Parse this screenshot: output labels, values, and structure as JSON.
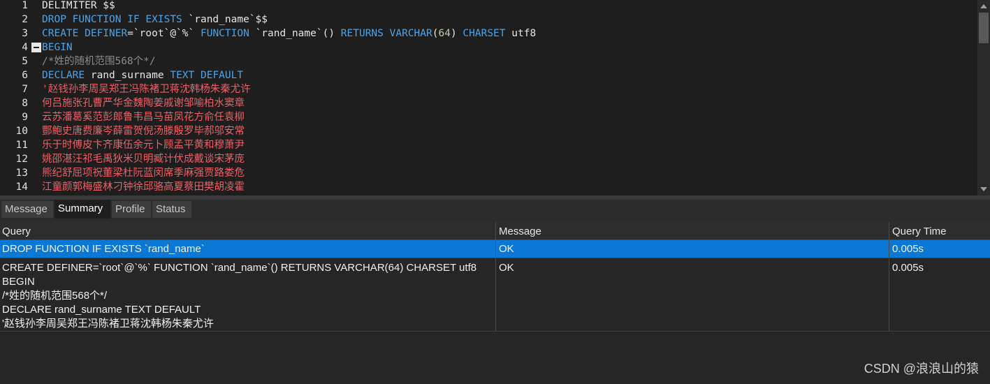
{
  "editor": {
    "lines": [
      {
        "n": "1",
        "parts": [
          {
            "c": "tx",
            "t": "DELIMITER $$"
          }
        ]
      },
      {
        "n": "2",
        "parts": [
          {
            "c": "kw",
            "t": "DROP FUNCTION IF EXISTS "
          },
          {
            "c": "tx",
            "t": "`rand_name`$$"
          }
        ]
      },
      {
        "n": "3",
        "parts": [
          {
            "c": "kw",
            "t": "CREATE DEFINER"
          },
          {
            "c": "tx",
            "t": "=`root`@`%` "
          },
          {
            "c": "kw",
            "t": "FUNCTION "
          },
          {
            "c": "tx",
            "t": "`rand_name`() "
          },
          {
            "c": "kw",
            "t": "RETURNS VARCHAR"
          },
          {
            "c": "tx",
            "t": "("
          },
          {
            "c": "nm",
            "t": "64"
          },
          {
            "c": "tx",
            "t": ") "
          },
          {
            "c": "kw",
            "t": "CHARSET "
          },
          {
            "c": "tx",
            "t": "utf8"
          }
        ]
      },
      {
        "n": "4",
        "parts": [
          {
            "c": "kw",
            "t": "BEGIN"
          }
        ],
        "fold": true
      },
      {
        "n": "5",
        "parts": [
          {
            "c": "cm",
            "t": "/*姓的随机范围568个*/"
          }
        ]
      },
      {
        "n": "6",
        "parts": [
          {
            "c": "kw",
            "t": "DECLARE "
          },
          {
            "c": "tx",
            "t": "rand_surname "
          },
          {
            "c": "kw",
            "t": "TEXT DEFAULT"
          }
        ]
      },
      {
        "n": "7",
        "parts": [
          {
            "c": "st",
            "t": "'赵钱孙李周吴郑王冯陈褚卫蒋沈韩杨朱秦尤许"
          }
        ]
      },
      {
        "n": "8",
        "parts": [
          {
            "c": "st",
            "t": "何吕施张孔曹严华金魏陶姜戚谢邹喻柏水窦章"
          }
        ]
      },
      {
        "n": "9",
        "parts": [
          {
            "c": "st",
            "t": "云苏潘葛奚范彭郎鲁韦昌马苗凤花方俞任袁柳"
          }
        ]
      },
      {
        "n": "10",
        "parts": [
          {
            "c": "st",
            "t": "酆鲍史唐费廉岑薛雷贺倪汤滕殷罗毕郝邬安常"
          }
        ]
      },
      {
        "n": "11",
        "parts": [
          {
            "c": "st",
            "t": "乐于时傅皮卞齐康伍余元卜顾孟平黄和穆萧尹"
          }
        ]
      },
      {
        "n": "12",
        "parts": [
          {
            "c": "st",
            "t": "姚邵湛汪祁毛禹狄米贝明臧计伏成戴谈宋茅庞"
          }
        ]
      },
      {
        "n": "13",
        "parts": [
          {
            "c": "st",
            "t": "熊纪舒屈项祝董梁杜阮蓝闵席季麻强贾路娄危"
          }
        ]
      },
      {
        "n": "14",
        "parts": [
          {
            "c": "st",
            "t": "江童颜郭梅盛林刁钟徐邱骆高夏蔡田樊胡凌霍"
          }
        ]
      }
    ]
  },
  "tabs": [
    {
      "label": "Message",
      "active": false
    },
    {
      "label": "Summary",
      "active": true
    },
    {
      "label": "Profile",
      "active": false
    },
    {
      "label": "Status",
      "active": false
    }
  ],
  "grid": {
    "columns": [
      "Query",
      "Message",
      "Query Time"
    ],
    "rows": [
      {
        "query": "DROP FUNCTION IF EXISTS `rand_name`",
        "message": "OK",
        "time": "0.005s",
        "selected": true
      },
      {
        "query": "CREATE DEFINER=`root`@`%` FUNCTION `rand_name`() RETURNS VARCHAR(64) CHARSET utf8\nBEGIN\n/*姓的随机范围568个*/\nDECLARE rand_surname TEXT DEFAULT\n'赵钱孙李周吴郑王冯陈褚卫蒋沈韩杨朱秦尤许",
        "message": "OK",
        "time": "0.005s",
        "selected": false
      }
    ]
  },
  "watermark": "CSDN @浪浪山的猿",
  "colors": {
    "keyword": "#4ea3e6",
    "string": "#ec5f67",
    "comment": "#8a8a8a",
    "number": "#b5cea8",
    "selection": "#0a78d4"
  }
}
